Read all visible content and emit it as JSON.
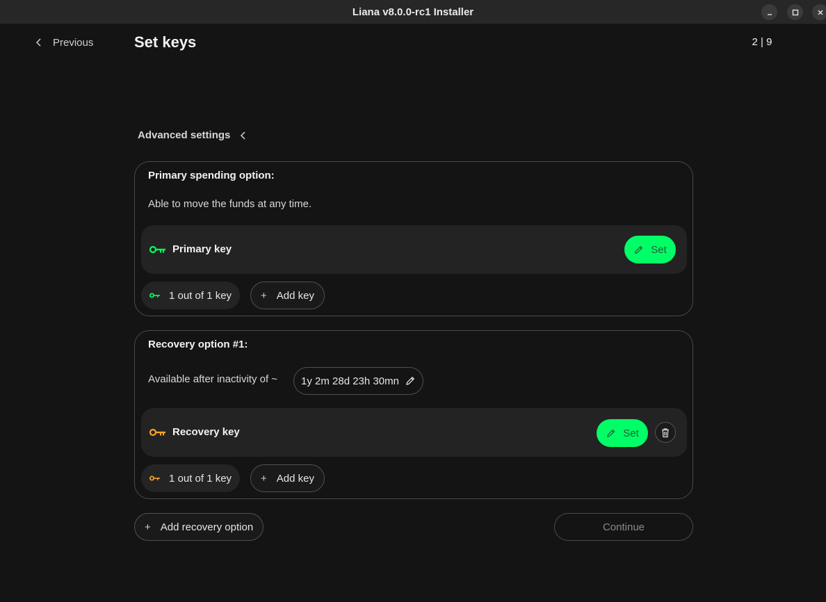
{
  "window": {
    "title": "Liana v8.0.0-rc1 Installer"
  },
  "header": {
    "previous_label": "Previous",
    "page_title": "Set keys",
    "step_indicator": "2 | 9"
  },
  "advanced_settings_label": "Advanced settings",
  "primary": {
    "title": "Primary spending option:",
    "description": "Able to move the funds at any time.",
    "key_name": "Primary key",
    "set_label": "Set",
    "count_label": "1 out of 1 key",
    "add_key_label": "Add key",
    "key_color": "#00ff66"
  },
  "recovery": {
    "title": "Recovery option #1:",
    "description": "Available after inactivity of ~",
    "timelock": "1y 2m 28d 23h 30mn",
    "key_name": "Recovery key",
    "set_label": "Set",
    "count_label": "1 out of 1 key",
    "add_key_label": "Add key",
    "key_color": "#f6a623"
  },
  "footer": {
    "add_recovery_label": "Add recovery option",
    "continue_label": "Continue"
  },
  "icons": [
    "chevron-left-icon",
    "minimize-icon",
    "maximize-icon",
    "close-icon",
    "key-icon",
    "pencil-icon",
    "trash-icon",
    "plus-icon"
  ],
  "colors": {
    "background": "#141414",
    "accent": "#00ff66",
    "recovery_accent": "#f6a623"
  }
}
